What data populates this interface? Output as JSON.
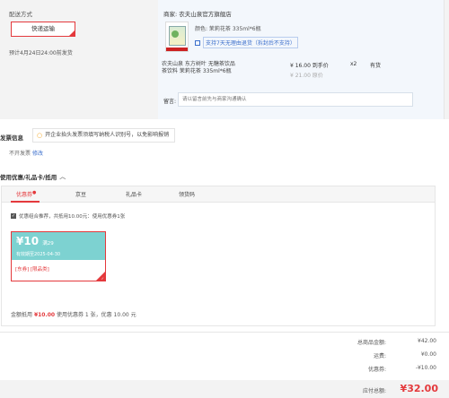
{
  "shipping": {
    "title": "配送方式",
    "method": "快递运输",
    "estimate": "预计4月24日24:00前发货"
  },
  "product": {
    "store": "商家: 农夫山泉官方旗舰店",
    "color": "颜色: 茉莉花茶 335ml*6瓶",
    "return_policy": "支持7天无理由退货（拆封后不支持）",
    "name": "农夫山泉 东方树叶 无糖茶饮品 茶饮料 茉莉花茶 335ml*6瓶",
    "price": "¥ 16.00 到手价",
    "original_price": "¥ 21.00 原价",
    "quantity": "x2",
    "stock": "有货",
    "memo_label": "留言:",
    "memo_placeholder": "请以留言前先与商家沟通确认"
  },
  "invoice": {
    "title": "发票信息",
    "tip": "开企业抬头发票须填写纳税人识别号，以免影响报销",
    "status": "不开发票",
    "edit": "修改"
  },
  "coupons": {
    "title": "使用优惠/礼品卡/抵用",
    "tabs": [
      {
        "label": "优惠券",
        "active": true
      },
      {
        "label": "京豆",
        "active": false
      },
      {
        "label": "礼品卡",
        "active": false
      },
      {
        "label": "领货码",
        "active": false
      }
    ],
    "combo_note": "优惠组合推荐，共抵用10.00元：使用优惠券1张",
    "card": {
      "amount": "¥10",
      "condition": "满29",
      "valid": "有效期至2025-04-30",
      "tags": "[东券] [限品类]"
    },
    "total_prefix": "金额抵用",
    "total_amount": "¥10.00",
    "total_suffix": "使用优惠券 1 张，优惠 10.00 元"
  },
  "summary": {
    "items": [
      {
        "label": "总商品金额:",
        "value": "¥42.00"
      },
      {
        "label": "运费:",
        "value": "¥0.00"
      },
      {
        "label": "优惠券:",
        "value": "-¥10.00"
      }
    ],
    "pay_label": "应付总额:",
    "pay_amount": "¥32.00"
  },
  "colors": {
    "accent": "#e4393c",
    "coupon_teal": "#7dd2d1",
    "link_blue": "#3b6fcc"
  }
}
